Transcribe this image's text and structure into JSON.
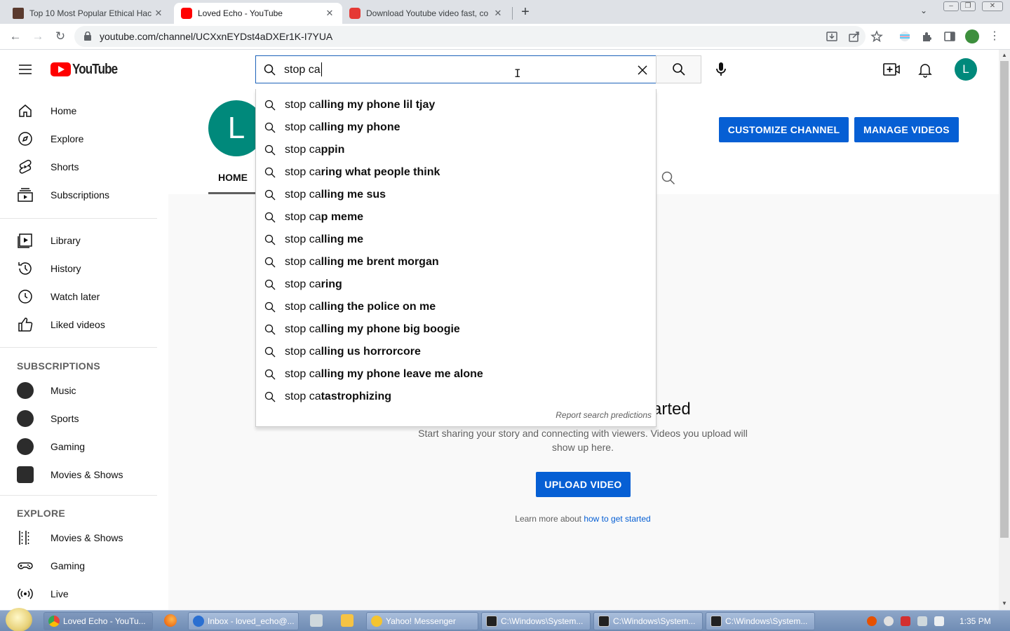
{
  "browser": {
    "tabs": [
      {
        "title": "Top 10 Most Popular Ethical Hac",
        "favicon_color": "#5a3a2e"
      },
      {
        "title": "Loved Echo - YouTube",
        "favicon_color": "#ff0000"
      },
      {
        "title": "Download Youtube video fast, co",
        "favicon_color": "#e53935"
      }
    ],
    "url": "youtube.com/channel/UCXxnEYDst4aDXEr1K-I7YUA"
  },
  "masthead": {
    "logo_text": "YouTube",
    "search_value": "stop ca",
    "avatar_letter": "L"
  },
  "sidebar": {
    "main": [
      "Home",
      "Explore",
      "Shorts",
      "Subscriptions"
    ],
    "library": [
      "Library",
      "History",
      "Watch later",
      "Liked videos"
    ],
    "subscriptions_heading": "SUBSCRIPTIONS",
    "subscriptions": [
      "Music",
      "Sports",
      "Gaming",
      "Movies & Shows"
    ],
    "explore_heading": "EXPLORE",
    "explore": [
      "Movies & Shows",
      "Gaming",
      "Live"
    ]
  },
  "suggestions": {
    "typed": "stop ca",
    "items": [
      {
        "typed": "stop ca",
        "rest": "lling my phone lil tjay"
      },
      {
        "typed": "stop ca",
        "rest": "lling my phone"
      },
      {
        "typed": "stop ca",
        "rest": "ppin"
      },
      {
        "typed": "stop ca",
        "rest": "ring what people think"
      },
      {
        "typed": "stop ca",
        "rest": "lling me sus"
      },
      {
        "typed": "stop ca",
        "rest": "p meme"
      },
      {
        "typed": "stop ca",
        "rest": "lling me"
      },
      {
        "typed": "stop ca",
        "rest": "lling me brent morgan"
      },
      {
        "typed": "stop ca",
        "rest": "ring"
      },
      {
        "typed": "stop ca",
        "rest": "lling the police on me"
      },
      {
        "typed": "stop ca",
        "rest": "lling my phone big boogie"
      },
      {
        "typed": "stop ca",
        "rest": "lling us horrorcore"
      },
      {
        "typed": "stop ca",
        "rest": "lling my phone leave me alone"
      },
      {
        "typed": "stop ca",
        "rest": "tastrophizing"
      }
    ],
    "report": "Report search predictions"
  },
  "channel": {
    "avatar_letter": "L",
    "customize_label": "CUSTOMIZE CHANNEL",
    "manage_label": "MANAGE VIDEOS",
    "tab_home": "HOME",
    "empty_title_visible": "arted",
    "empty_desc": "Start sharing your story and connecting with viewers. Videos you upload will show up here.",
    "upload_label": "UPLOAD VIDEO",
    "learn_prefix": "Learn more about ",
    "learn_link": "how to get started"
  },
  "taskbar": {
    "items": [
      {
        "label": "Loved Echo - YouTu...",
        "active": true,
        "icon_color": "#ea4335"
      },
      {
        "label": "Inbox - loved_echo@...",
        "active": false,
        "icon_color": "#2a6fd1"
      },
      {
        "label": "Yahoo! Messenger",
        "active": false,
        "icon_color": "#f4c430"
      },
      {
        "label": "C:\\Windows\\System...",
        "active": false,
        "icon_color": "#222222"
      },
      {
        "label": "C:\\Windows\\System...",
        "active": false,
        "icon_color": "#222222"
      },
      {
        "label": "C:\\Windows\\System...",
        "active": false,
        "icon_color": "#222222"
      }
    ],
    "clock": "1:35 PM"
  },
  "colors": {
    "accent": "#065fd4",
    "brand_red": "#ff0000",
    "avatar_teal": "#00897b"
  }
}
